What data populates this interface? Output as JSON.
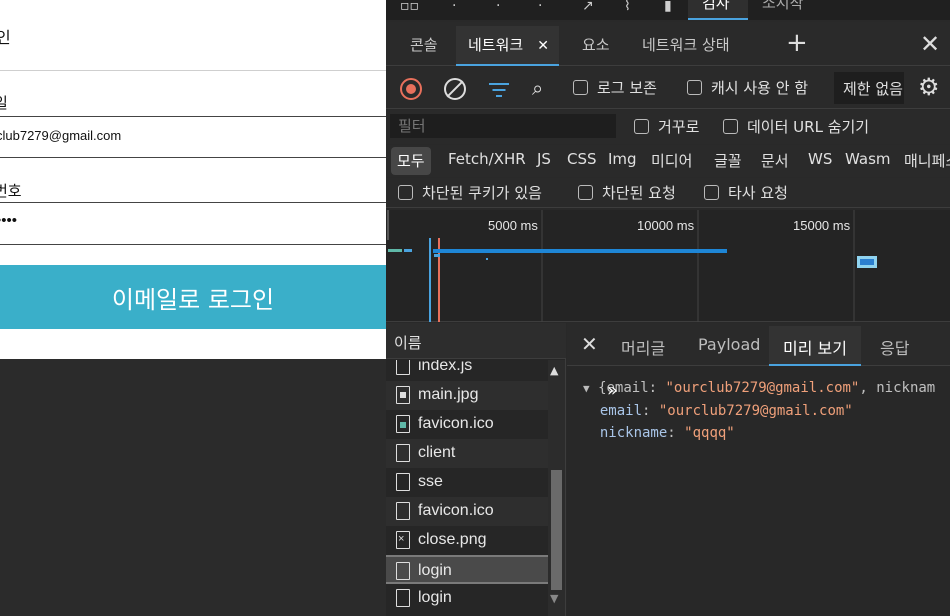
{
  "page": {
    "heading": "인",
    "email_label": "일",
    "email_value": "club7279@gmail.com",
    "password_label": "번호",
    "password_mask": "••••",
    "login_button": "이메일로 로그인",
    "login_button_color": "#3aafc9"
  },
  "devtools": {
    "top_tabs": {
      "selected": "검사",
      "next": "소시작"
    },
    "tabs": [
      {
        "label": "콘솔"
      },
      {
        "label": "네트워크",
        "active": true,
        "close": "✕"
      },
      {
        "label": "요소"
      },
      {
        "label": "네트워크 상태"
      }
    ],
    "add_tab_icon": "+",
    "close_icon": "✕",
    "toolbar": {
      "preserve_log": "로그 보존",
      "disable_cache": "캐시 사용 안 함",
      "throttling": "제한 없음"
    },
    "filter": {
      "placeholder": "필터",
      "invert": "거꾸로",
      "hide_data_urls": "데이터 URL 숨기기"
    },
    "type_filters": [
      "모두",
      "Fetch/XHR",
      "JS",
      "CSS",
      "Img",
      "미디어",
      "글꼴",
      "문서",
      "WS",
      "Wasm",
      "매니페스트"
    ],
    "block_filters": {
      "blocked_cookies": "차단된 쿠키가 있음",
      "blocked_requests": "차단된 요청",
      "third_party": "타사 요청"
    },
    "timeline": {
      "ticks": [
        "5000 ms",
        "10000 ms",
        "15000 ms"
      ]
    },
    "request_list": {
      "header": "이름",
      "rows": [
        {
          "name": "index.js",
          "icon": "file"
        },
        {
          "name": "main.jpg",
          "icon": "img"
        },
        {
          "name": "favicon.ico",
          "icon": "ico"
        },
        {
          "name": "client",
          "icon": "file"
        },
        {
          "name": "sse",
          "icon": "file"
        },
        {
          "name": "favicon.ico",
          "icon": "file"
        },
        {
          "name": "close.png",
          "icon": "png"
        },
        {
          "name": "login",
          "icon": "file",
          "selected": true
        },
        {
          "name": "login",
          "icon": "file"
        }
      ]
    },
    "detail": {
      "close_icon": "✕",
      "tabs": [
        "머리글",
        "Payload",
        "미리 보기",
        "응답"
      ],
      "active_tab": "미리 보기",
      "preview": {
        "summary_prefix": "{email: ",
        "summary_email": "\"ourclub7279@gmail.com\"",
        "summary_suffix": ", nicknam",
        "email_key": "email",
        "email_value": "\"ourclub7279@gmail.com\"",
        "nickname_key": "nickname",
        "nickname_value": "\"qqqq\""
      }
    },
    "accent_color": "#4aa3df",
    "record_color": "#e8705c"
  }
}
